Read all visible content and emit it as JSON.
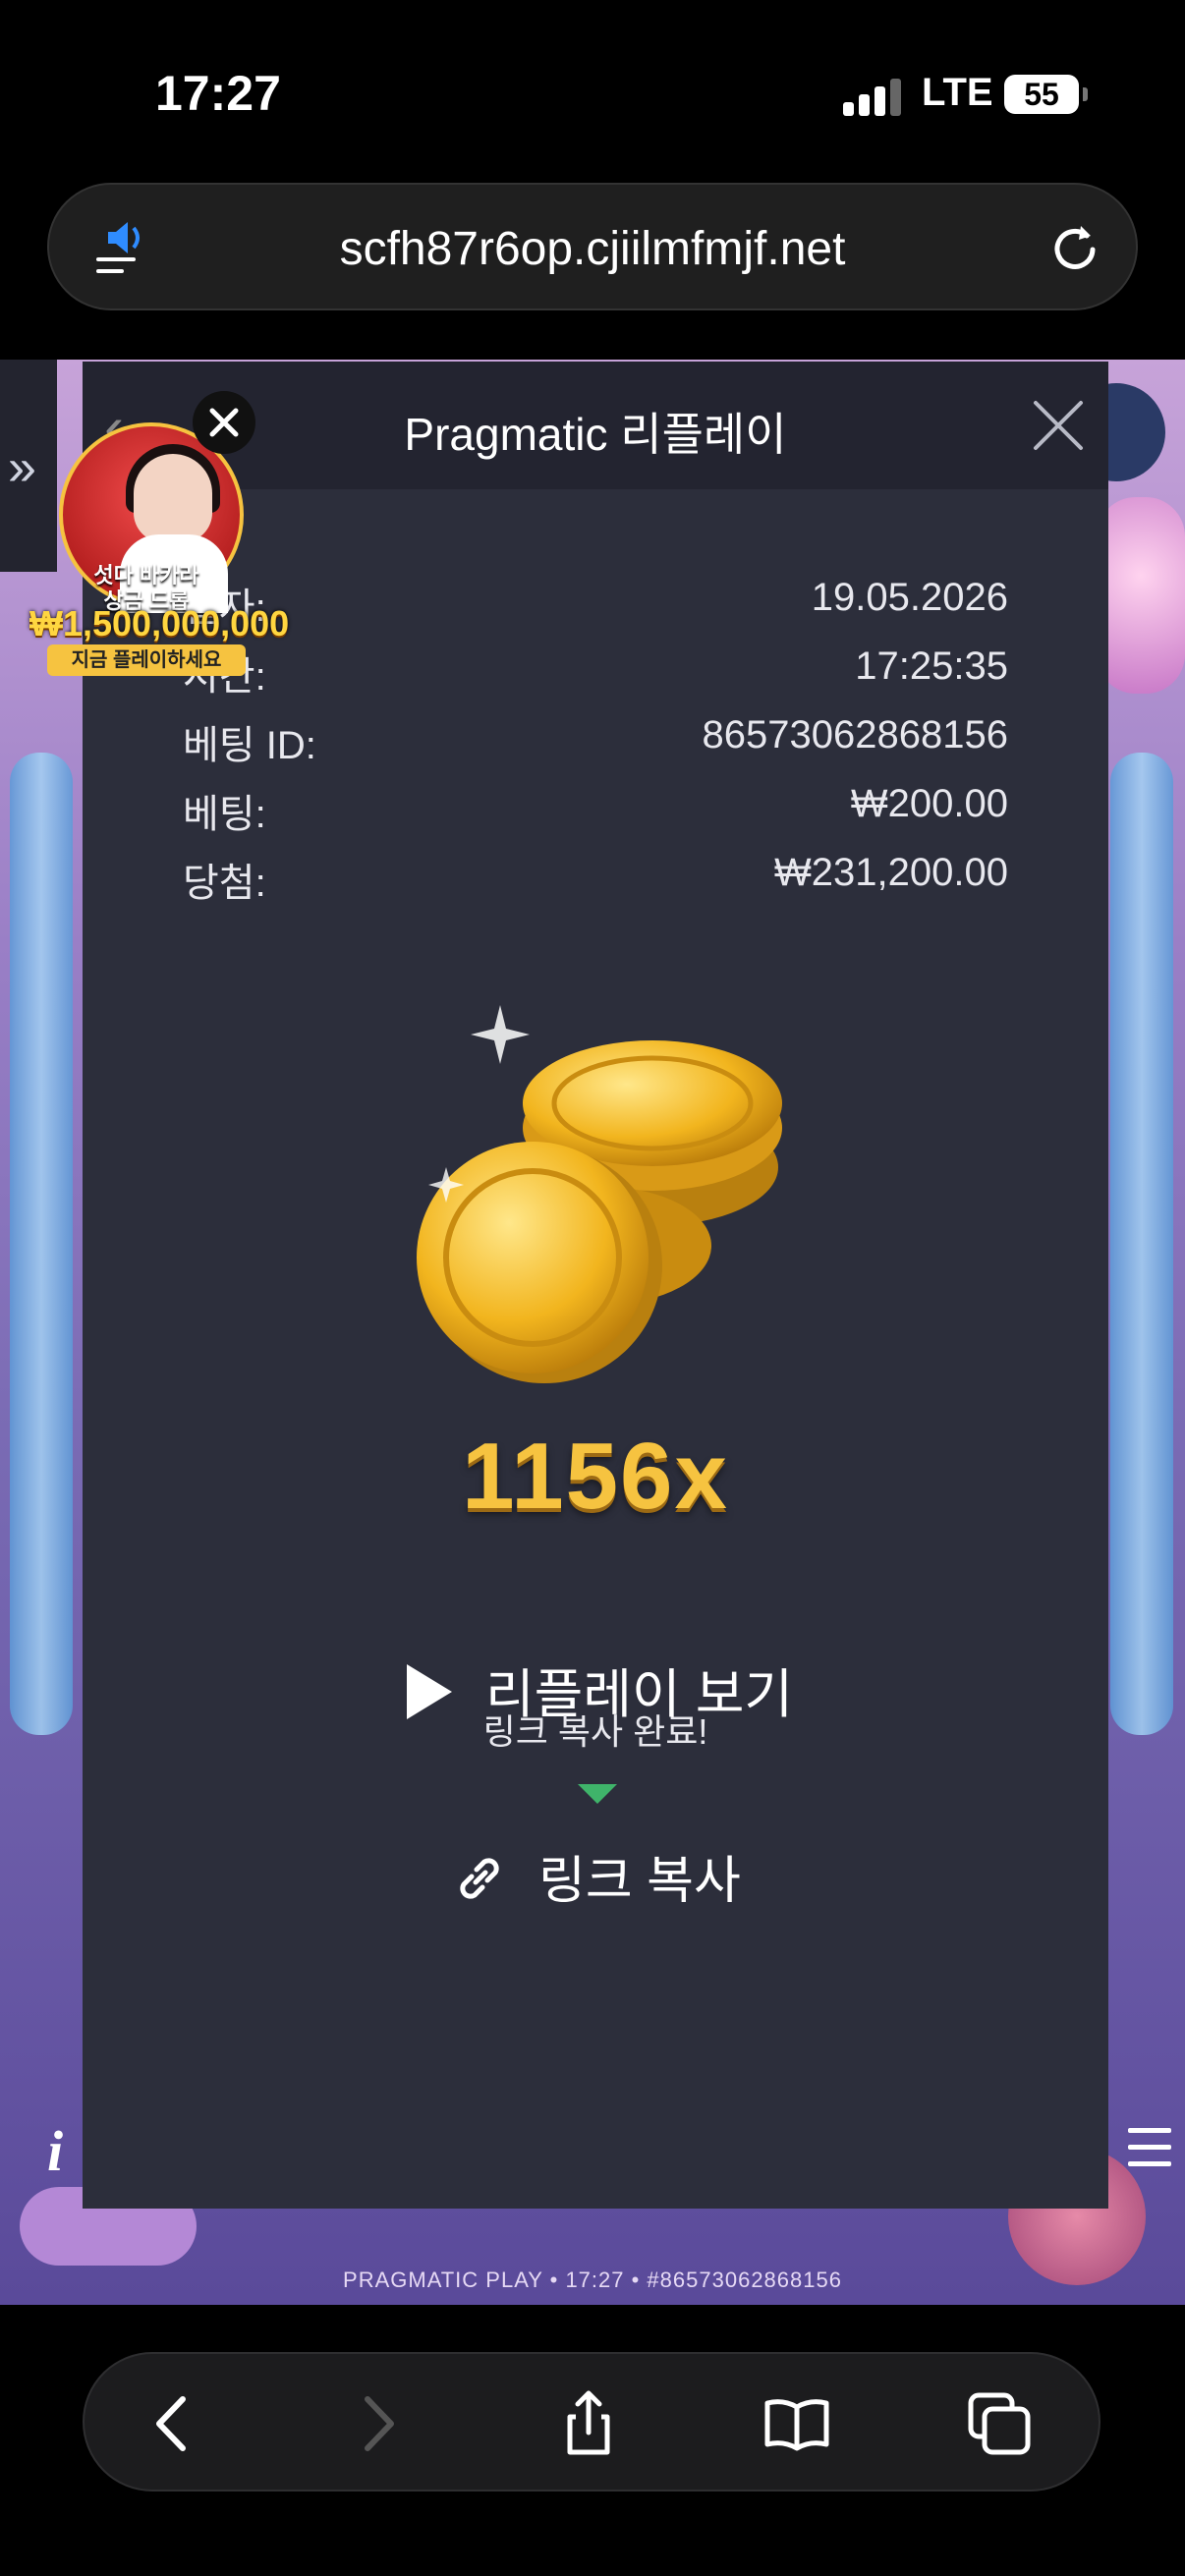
{
  "status_bar": {
    "time": "17:27",
    "network": "LTE",
    "battery": "55"
  },
  "browser": {
    "url": "scfh87r6op.cjiilmfmjf.net"
  },
  "modal": {
    "title": "Pragmatic 리플레이",
    "rows": [
      {
        "label": "일자:",
        "value": "19.05.2026"
      },
      {
        "label": "시간:",
        "value": "17:25:35"
      },
      {
        "label": "베팅 ID:",
        "value": "86573062868156"
      },
      {
        "label": "베팅:",
        "value": "₩200.00"
      },
      {
        "label": "당첨:",
        "value": "₩231,200.00"
      }
    ],
    "multiplier": "1156x",
    "replay_label": "리플레이 보기",
    "copied_notice": "링크 복사 완료!",
    "copy_link_label": "링크 복사",
    "accent_color": "#3fb46a"
  },
  "promo": {
    "line1": "섯다 바카라",
    "line2": "상금 드롭",
    "amount": "₩1,500,000,000",
    "cta": "지금 플레이하세요"
  },
  "game": {
    "footer_caption": "PRAGMATIC PLAY • 17:27 • #86573062868156",
    "info_label": "i"
  }
}
